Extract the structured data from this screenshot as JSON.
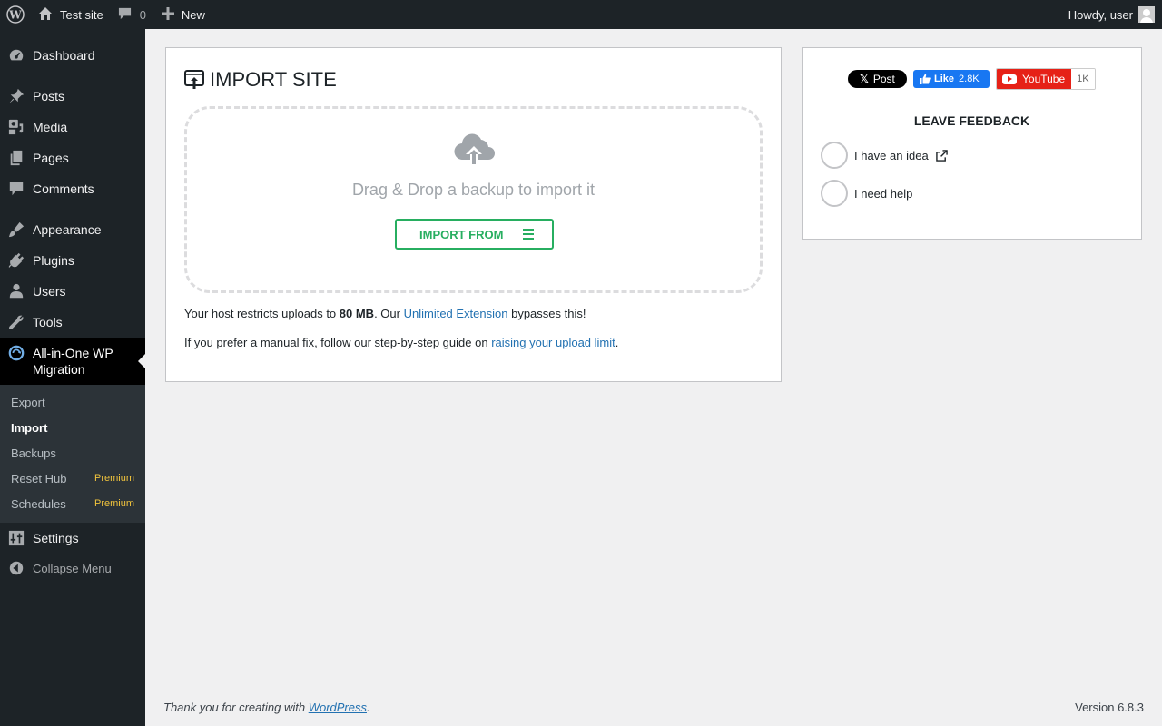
{
  "adminbar": {
    "site_name": "Test site",
    "comments_count": "0",
    "new_label": "New",
    "howdy": "Howdy, user"
  },
  "sidebar": {
    "items": [
      {
        "label": "Dashboard",
        "icon": "dashboard-icon"
      },
      {
        "label": "Posts",
        "icon": "pushpin-icon"
      },
      {
        "label": "Media",
        "icon": "media-icon"
      },
      {
        "label": "Pages",
        "icon": "pages-icon"
      },
      {
        "label": "Comments",
        "icon": "comment-icon"
      },
      {
        "label": "Appearance",
        "icon": "paintbrush-icon"
      },
      {
        "label": "Plugins",
        "icon": "plug-icon"
      },
      {
        "label": "Users",
        "icon": "user-icon"
      },
      {
        "label": "Tools",
        "icon": "wrench-icon"
      },
      {
        "label": "All-in-One WP Migration",
        "icon": "migration-icon"
      },
      {
        "label": "Settings",
        "icon": "settings-icon"
      }
    ],
    "submenu": [
      {
        "label": "Export",
        "badge": ""
      },
      {
        "label": "Import",
        "badge": ""
      },
      {
        "label": "Backups",
        "badge": ""
      },
      {
        "label": "Reset Hub",
        "badge": "Premium"
      },
      {
        "label": "Schedules",
        "badge": "Premium"
      }
    ],
    "collapse_label": "Collapse Menu"
  },
  "import": {
    "title": "IMPORT SITE",
    "dropzone_text": "Drag & Drop a backup to import it",
    "button_label": "IMPORT FROM",
    "info1_pre": "Your host restricts uploads to ",
    "info1_size": "80 MB",
    "info1_mid": ". Our ",
    "info1_link": "Unlimited Extension",
    "info1_post": " bypasses this!",
    "info2_pre": "If you prefer a manual fix, follow our step-by-step guide on ",
    "info2_link": "raising your upload limit",
    "info2_post": "."
  },
  "social": {
    "x_label": "Post",
    "fb_like": "Like",
    "fb_count": "2.8K",
    "yt_label": "YouTube",
    "yt_count": "1K"
  },
  "feedback": {
    "title": "LEAVE FEEDBACK",
    "option1": "I have an idea",
    "option2": "I need help"
  },
  "footer": {
    "thanks_pre": "Thank you for creating with ",
    "thanks_link": "WordPress",
    "thanks_post": ".",
    "version": "Version 6.8.3"
  },
  "colors": {
    "accent_green": "#27ae60",
    "link_blue": "#2271b1",
    "premium_yellow": "#f0c33c",
    "admin_dark": "#1d2327"
  }
}
